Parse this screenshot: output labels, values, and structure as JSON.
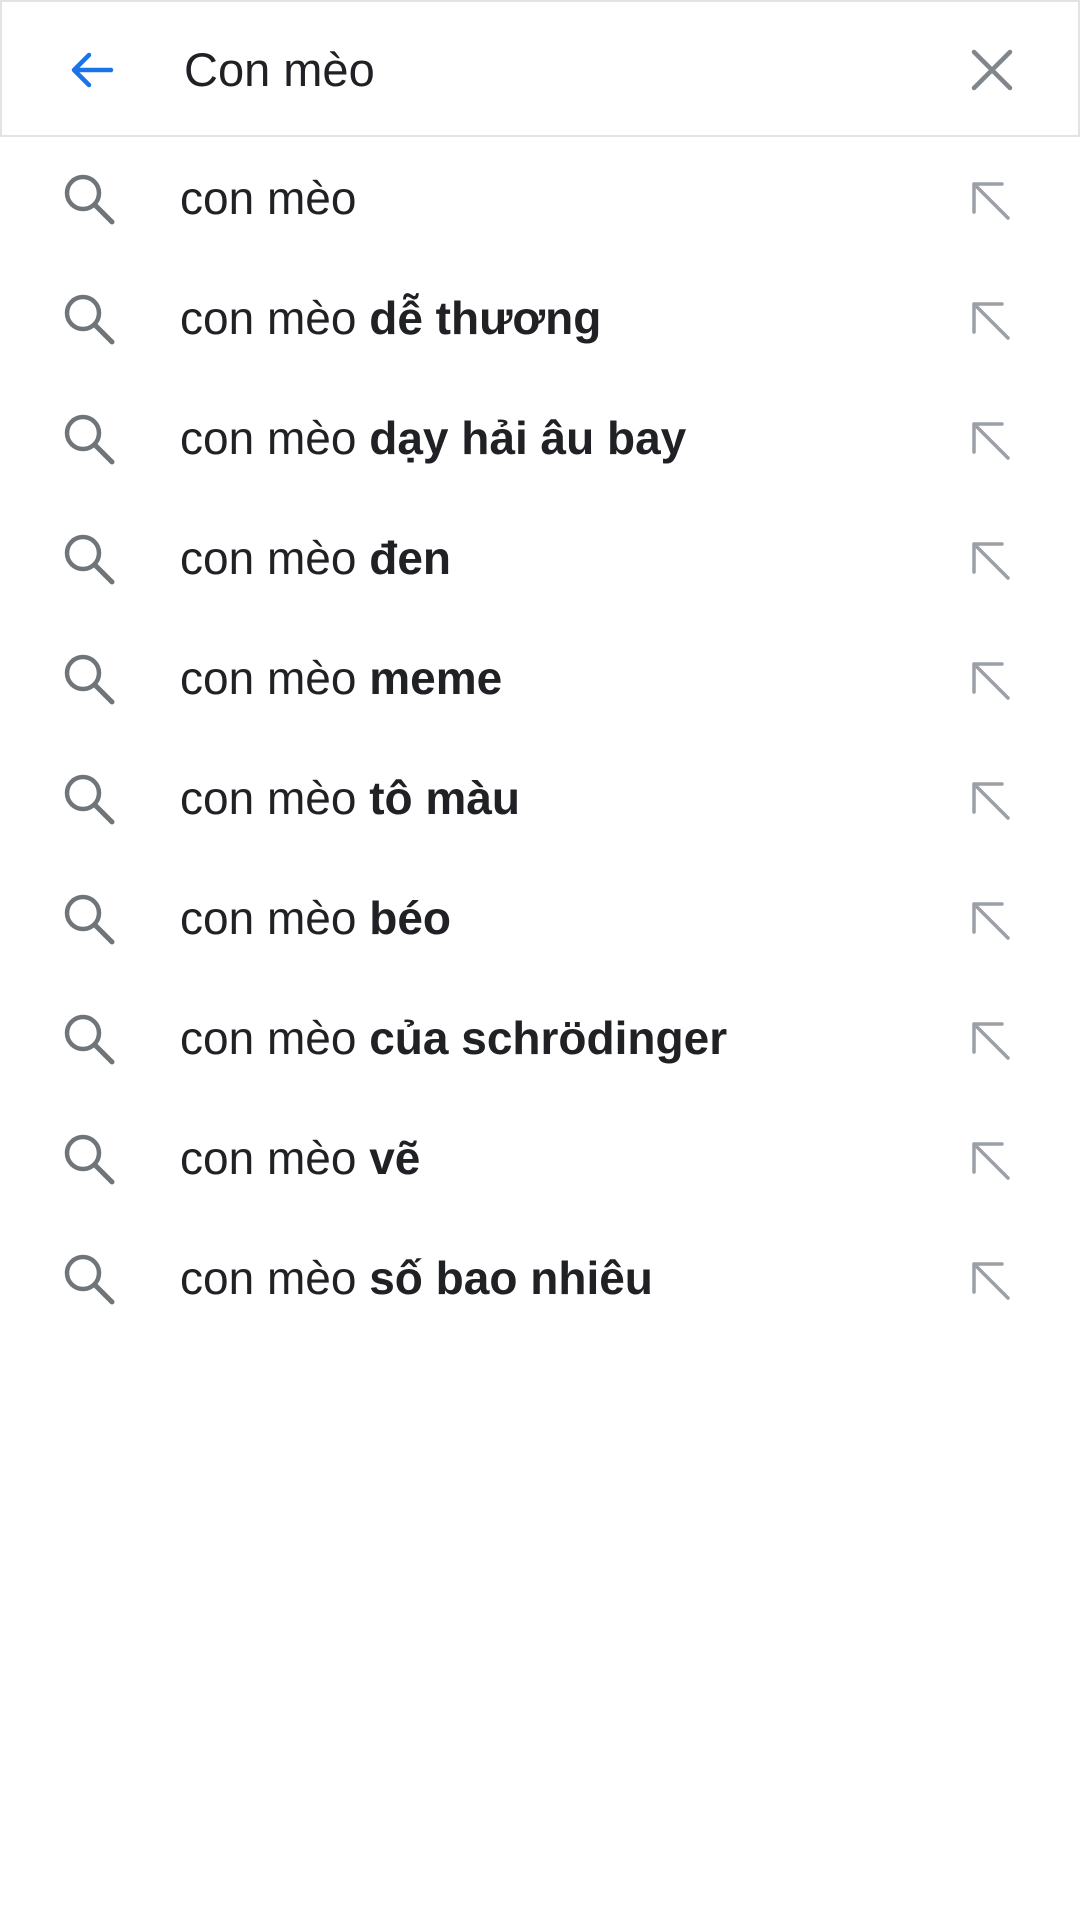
{
  "search": {
    "query": "Con mèo",
    "back_icon": "arrow-left-icon",
    "clear_icon": "close-icon"
  },
  "colors": {
    "accent": "#1a73e8",
    "text": "#202124",
    "icon_gray": "#70757a",
    "arrow_gray": "#9aa0a6",
    "divider": "#e3e3e6"
  },
  "suggestions": [
    {
      "prefix": "con mèo",
      "completion": ""
    },
    {
      "prefix": "con mèo ",
      "completion": "dễ thương"
    },
    {
      "prefix": "con mèo ",
      "completion": "dạy hải âu bay"
    },
    {
      "prefix": "con mèo ",
      "completion": "đen"
    },
    {
      "prefix": "con mèo ",
      "completion": "meme"
    },
    {
      "prefix": "con mèo ",
      "completion": "tô màu"
    },
    {
      "prefix": "con mèo ",
      "completion": "béo"
    },
    {
      "prefix": "con mèo ",
      "completion": "của schrödinger"
    },
    {
      "prefix": "con mèo ",
      "completion": "vẽ"
    },
    {
      "prefix": "con mèo ",
      "completion": "số bao nhiêu"
    }
  ]
}
